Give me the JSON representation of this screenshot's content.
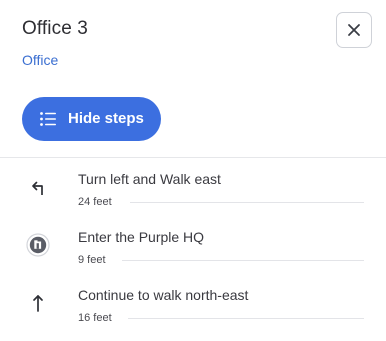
{
  "header": {
    "title": "Office 3",
    "subtitle": "Office"
  },
  "actions": {
    "hide_steps_label": "Hide steps"
  },
  "steps": [
    {
      "icon": "turn-left-arrow-icon",
      "text": "Turn left and Walk east",
      "distance": "24 feet"
    },
    {
      "icon": "building-entrance-icon",
      "text": "Enter the Purple HQ",
      "distance": "9 feet"
    },
    {
      "icon": "straight-arrow-up-icon",
      "text": "Continue to walk north-east",
      "distance": "16 feet"
    }
  ],
  "colors": {
    "accent": "#3c6fe0",
    "link": "#3b6fd1"
  }
}
